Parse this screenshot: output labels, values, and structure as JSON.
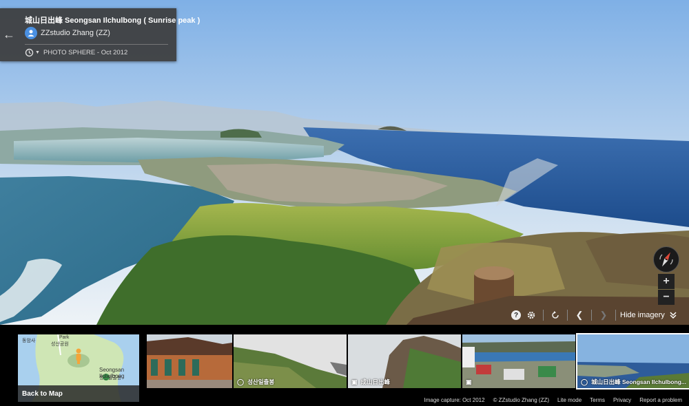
{
  "info_card": {
    "title": "城山日出峰 Seongsan Ilchulbong ( Sunrise peak )",
    "author": "ZZstudio Zhang (ZZ)",
    "photo_type": "PHOTO SPHERE - Oct 2012"
  },
  "toolbar": {
    "hide_imagery_label": "Hide imagery"
  },
  "map_thumb": {
    "back_label": "Back to Map",
    "place_label": "Seongsan Ilchulbong",
    "place_label_ko": "성산일출봉",
    "park_label": "Park",
    "park_label_ko": "성산공원",
    "temple_label": "동암사"
  },
  "thumbnails": [
    {
      "caption": ""
    },
    {
      "caption": "성산일출봉"
    },
    {
      "caption": "成山日出峰"
    },
    {
      "caption": ""
    },
    {
      "caption": "城山日出峰 Seongsan Ilchulbong..."
    }
  ],
  "footer": {
    "capture": "Image capture: Oct 2012",
    "copyright": "© ZZstudio Zhang (ZZ)",
    "lite": "Lite mode",
    "terms": "Terms",
    "privacy": "Privacy",
    "report": "Report a problem"
  },
  "colors": {
    "accent_blue": "#4a90e2",
    "card_bg": "#3c3c3c",
    "pin_orange": "#f4a53a"
  }
}
